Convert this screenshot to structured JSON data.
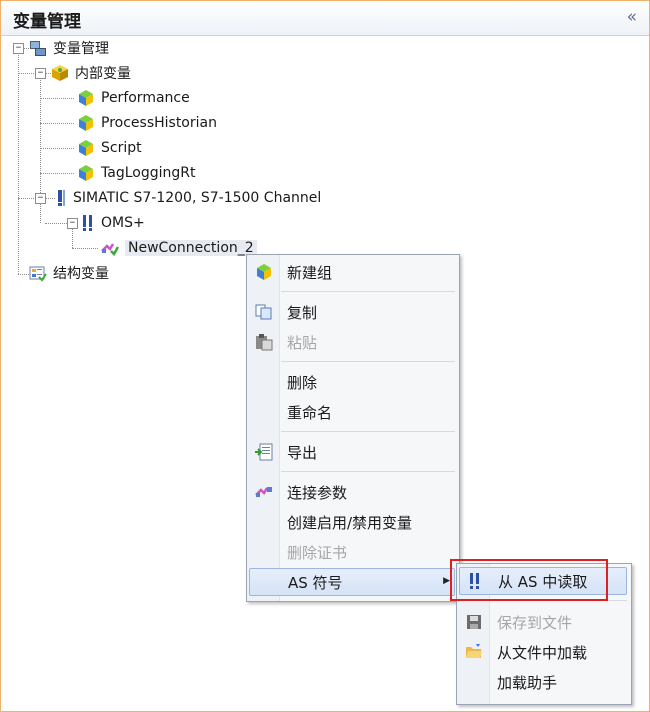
{
  "panel": {
    "title": "变量管理",
    "collapse_glyph": "«"
  },
  "tree": {
    "root": "变量管理",
    "internal": "内部变量",
    "internal_children": [
      "Performance",
      "ProcessHistorian",
      "Script",
      "TagLoggingRt"
    ],
    "channel": "SIMATIC S7-1200, S7-1500 Channel",
    "oms": "OMS+",
    "connection": "NewConnection_2",
    "struct": "结构变量"
  },
  "context_menu": {
    "new_group": "新建组",
    "copy": "复制",
    "paste": "粘贴",
    "delete": "删除",
    "rename": "重命名",
    "export": "导出",
    "connection_params": "连接参数",
    "create_enable_disable": "创建启用/禁用变量",
    "delete_cert": "删除证书",
    "as_symbol": "AS 符号",
    "submenu_arrow": "▶"
  },
  "submenu": {
    "read_from_as": "从 AS 中读取",
    "save_to_file": "保存到文件",
    "load_from_file": "从文件中加载",
    "load_assistant": "加载助手"
  },
  "colors": {
    "frame_border": "#f0b26a",
    "highlight_box": "#e02020",
    "selection": "#d5e3f7"
  }
}
